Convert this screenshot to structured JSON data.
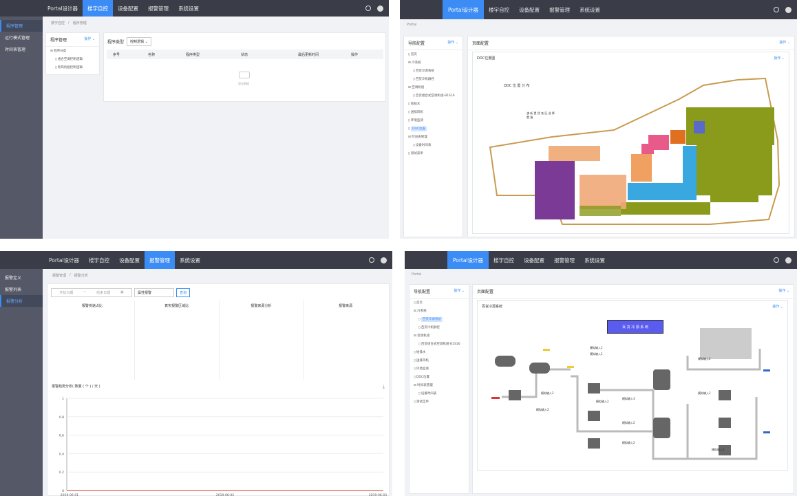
{
  "q1": {
    "nav": [
      "Portal设计器",
      "楼宇自控",
      "设备配置",
      "报警管理",
      "系统设置"
    ],
    "side": [
      "程序管理",
      "运行模式管理",
      "时间表管理"
    ],
    "crumb": [
      "楼宇自控",
      "/",
      "程序管理"
    ],
    "tree_title": "程序管理",
    "tree_op": "操作 ⌄",
    "tree": [
      "程序分类",
      "组合空调控制逻辑",
      "新风机组控制逻辑"
    ],
    "filter_label": "程序类型",
    "filter_value": "控制逻辑 ⌄",
    "columns": [
      "序号",
      "名称",
      "程序类型",
      "状态",
      "最后更新时间",
      "操作"
    ],
    "empty": "暂无数据"
  },
  "q2": {
    "nav": [
      "Portal设计器",
      "楼宇自控",
      "设备配置",
      "报警管理",
      "系统设置"
    ],
    "crumb": "Portal",
    "nav_title": "导航配置",
    "op": "操作 ⌄",
    "tree": [
      "首页",
      "冷系统",
      "百货冷源系统",
      "百货冷机群控",
      "空调机组",
      "百货组合式空调机组-B1S16",
      "给排水",
      "送排风机",
      "环境监测",
      "DDC位置",
      "时间表管理",
      "设备时间表",
      "测试菜单"
    ],
    "page_title": "页面配置",
    "inner_title": "DDC位置图",
    "map_title": "DDC 位 置 分 布",
    "map_note": "澳 新 提 货 各 区 选 择 置 指"
  },
  "q3": {
    "nav": [
      "Portal设计器",
      "楼宇自控",
      "设备配置",
      "报警管理",
      "系统设置"
    ],
    "side": [
      "报警定义",
      "报警列表",
      "报警分析"
    ],
    "crumb": [
      "报警管理",
      "/",
      "报警分析"
    ],
    "start_ph": "开始日期",
    "end_ph": "结束日期",
    "level": "属性报警",
    "query": "查询",
    "columns": [
      "报警快速占比",
      "真实报警区域比",
      "报警来源分析",
      "报警来源"
    ],
    "trend_title": "报警趋势分析( 数量 ( 个 ) / 天 )",
    "dl_icon": "download-icon",
    "yticks": [
      "1",
      "0.8",
      "0.6",
      "0.4",
      "0.2",
      "0"
    ],
    "xticks": [
      "2019-06-01",
      "2019-06-02",
      "2019-06-03"
    ]
  },
  "q4": {
    "nav": [
      "Portal设计器",
      "楼宇自控",
      "设备配置",
      "报警管理",
      "系统设置"
    ],
    "crumb": "Portal",
    "nav_title": "导航配置",
    "op": "操作 ⌄",
    "tree": [
      "首页",
      "冷系统",
      "百货冷源系统",
      "百货冷机群控",
      "空调机组",
      "百货组合式空调机组-B1S16",
      "给排水",
      "送排风机",
      "环境监测",
      "DDC位置",
      "时间表管理",
      "设备时间表",
      "测试菜单"
    ],
    "page_title": "页面配置",
    "inner_title": "百货冷源系统",
    "banner": "百 货 冷 源 系 统",
    "sim1": "模拟输入1",
    "sim2": "模拟输入2",
    "sim3": "模拟输入3"
  }
}
